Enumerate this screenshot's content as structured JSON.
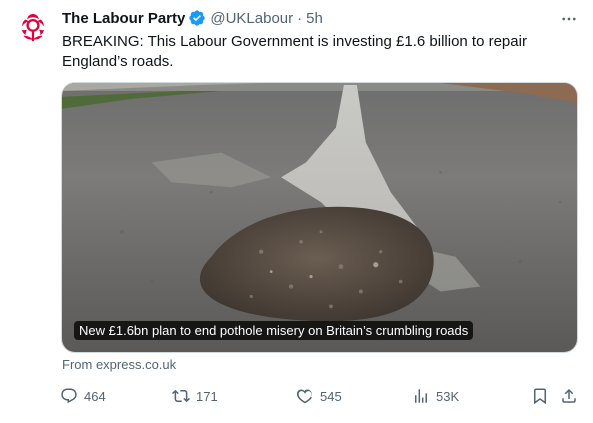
{
  "author": {
    "name": "The Labour Party",
    "handle": "@UKLabour",
    "separator": "·",
    "time": "5h"
  },
  "tweet": {
    "text": "BREAKING: This Labour Government is investing £1.6 billion to repair England’s roads."
  },
  "card": {
    "caption": "New £1.6bn plan to end pothole misery on Britain’s crumbling roads",
    "source": "From express.co.uk"
  },
  "actions": {
    "replies": "464",
    "reposts": "171",
    "likes": "545",
    "views": "53K"
  },
  "icons": {
    "verified": "verified-badge-icon",
    "more": "more-options-icon",
    "reply": "reply-icon",
    "repost": "repost-icon",
    "like": "heart-icon",
    "views": "views-chart-icon",
    "bookmark": "bookmark-icon",
    "share": "share-icon"
  },
  "colors": {
    "brand_red": "#e4003b",
    "verified_blue": "#1d9bf0",
    "text_primary": "#0f1419",
    "text_secondary": "#536471"
  }
}
